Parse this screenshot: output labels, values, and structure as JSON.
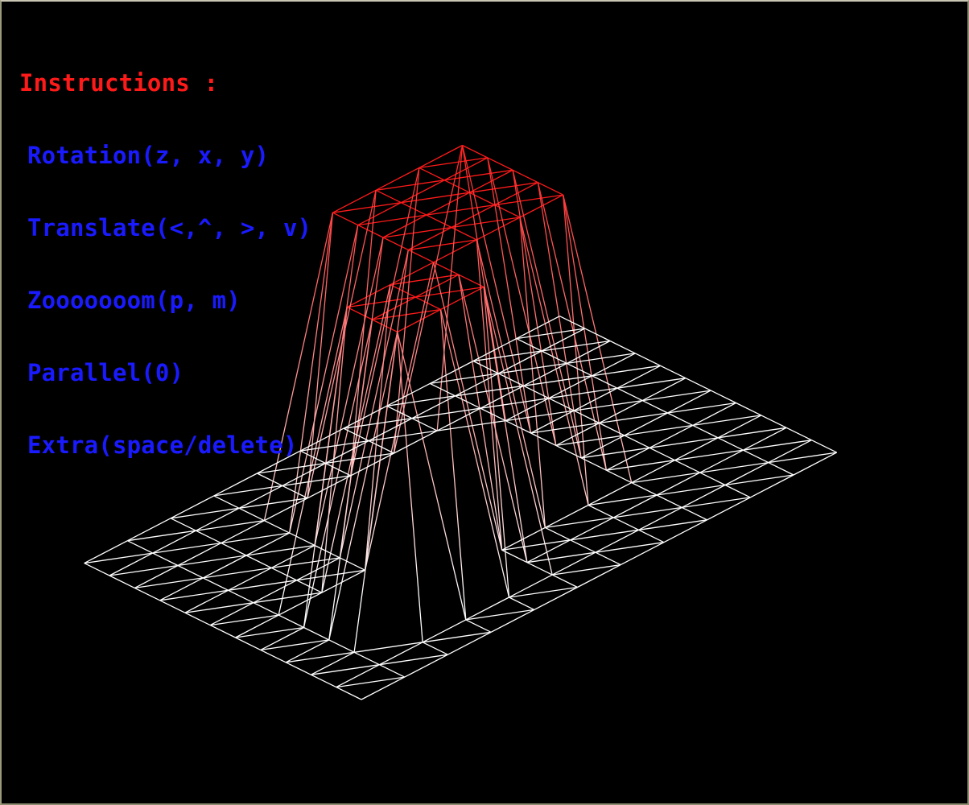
{
  "instructions": {
    "title": "Instructions :",
    "lines": [
      "Rotation(z, x, y)",
      "Translate(<,^, >, v)",
      "Zooooooom(p, m)",
      "Parallel(0)",
      "Extra(space/delete)"
    ]
  },
  "colors": {
    "background": "#000000",
    "title_text": "#ff1a1a",
    "instruction_text": "#1a1aff",
    "grid_low": "#ffffff",
    "grid_high": "#ff1a1a"
  },
  "heightmap": {
    "rows": 12,
    "cols": 12,
    "raised_height": 1,
    "raised_cells": [
      [
        2,
        2
      ],
      [
        2,
        3
      ],
      [
        2,
        4
      ],
      [
        3,
        2
      ],
      [
        3,
        3
      ],
      [
        3,
        4
      ],
      [
        4,
        2
      ],
      [
        4,
        3
      ],
      [
        4,
        4
      ],
      [
        4,
        5
      ],
      [
        4,
        6
      ],
      [
        4,
        7
      ],
      [
        4,
        8
      ],
      [
        5,
        4
      ],
      [
        5,
        5
      ],
      [
        5,
        6
      ],
      [
        5,
        7
      ],
      [
        5,
        8
      ],
      [
        6,
        4
      ],
      [
        6,
        5
      ],
      [
        6,
        6
      ],
      [
        6,
        7
      ],
      [
        6,
        8
      ],
      [
        7,
        4
      ],
      [
        7,
        5
      ],
      [
        7,
        6
      ],
      [
        7,
        7
      ],
      [
        7,
        8
      ]
    ]
  }
}
